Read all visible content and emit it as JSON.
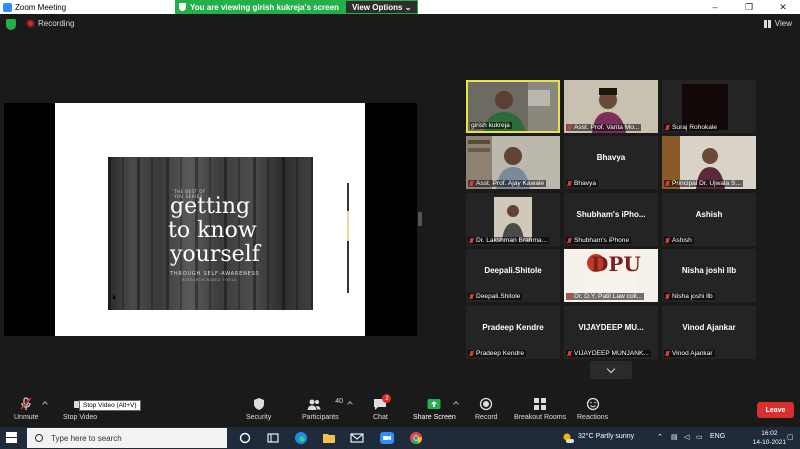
{
  "window": {
    "title": "Zoom Meeting",
    "controls": [
      "–",
      "❐",
      "✕"
    ]
  },
  "banner": {
    "viewing_text": "You are viewing girish kukreja's screen",
    "view_options": "View Options ⌄"
  },
  "meeting_bar": {
    "recording": "Recording",
    "view": "View"
  },
  "slide": {
    "small1": "THE BEST OF",
    "small2": "YOU SERIES",
    "line1": "getting",
    "line2": "to know",
    "line3": "yourself",
    "subtitle": "THROUGH SELF-AWARENESS",
    "subtitle2": "RESEARCH-BASED TOOLS"
  },
  "participants": [
    {
      "label": "girish kukreja",
      "center": "",
      "video": "person1",
      "active": true,
      "muted": false
    },
    {
      "label": "Asst. Prof. Varita Mo...",
      "center": "",
      "video": "person2",
      "active": false,
      "muted": true
    },
    {
      "label": "Suraj Rohokale",
      "center": "",
      "video": "dark",
      "active": false,
      "muted": true
    },
    {
      "label": "Asst. Prof. Ajay Kawale",
      "center": "",
      "video": "person3",
      "active": false,
      "muted": true
    },
    {
      "label": "Bhavya",
      "center": "Bhavya",
      "video": "",
      "active": false,
      "muted": true
    },
    {
      "label": "Principal Dr. Ujwala S...",
      "center": "",
      "video": "person4",
      "active": false,
      "muted": true
    },
    {
      "label": "Dr. Lakshman Brahma...",
      "center": "",
      "video": "person5",
      "active": false,
      "muted": true
    },
    {
      "label": "Shubham's iPhone",
      "center": "Shubham's  iPho...",
      "video": "",
      "active": false,
      "muted": true
    },
    {
      "label": "Ashish",
      "center": "Ashish",
      "video": "",
      "active": false,
      "muted": true
    },
    {
      "label": "Deepali.Shitole",
      "center": "Deepali.Shitole",
      "video": "",
      "active": false,
      "muted": true
    },
    {
      "label": "Dr. D.Y. Patil Law coll...",
      "center": "",
      "video": "logo",
      "active": false,
      "muted": true
    },
    {
      "label": "Nisha joshi llb",
      "center": "Nisha joshi llb",
      "video": "",
      "active": false,
      "muted": true
    },
    {
      "label": "Pradeep Kendre",
      "center": "Pradeep Kendre",
      "video": "",
      "active": false,
      "muted": true
    },
    {
      "label": "VIJAYDEEP MUNJANK...",
      "center": "VIJAYDEEP  MU...",
      "video": "",
      "active": false,
      "muted": true
    },
    {
      "label": "Vinod Ajankar",
      "center": "Vinod Ajankar",
      "video": "",
      "active": false,
      "muted": true
    }
  ],
  "logo_text": "DPU",
  "toolbar": {
    "unmute": "Unmute",
    "stop_video": "Stop Video",
    "tooltip": "Stop Video (Alt+V)",
    "security": "Security",
    "participants": "Participants",
    "participants_count": "40",
    "chat": "Chat",
    "chat_badge": "2",
    "share_screen": "Share Screen",
    "record": "Record",
    "breakout": "Breakout Rooms",
    "reactions": "Reactions",
    "leave": "Leave"
  },
  "taskbar": {
    "search_placeholder": "Type here to search",
    "weather": "32°C  Partly sunny",
    "lang": "ENG",
    "time": "16:02",
    "date": "14-10-2021"
  }
}
